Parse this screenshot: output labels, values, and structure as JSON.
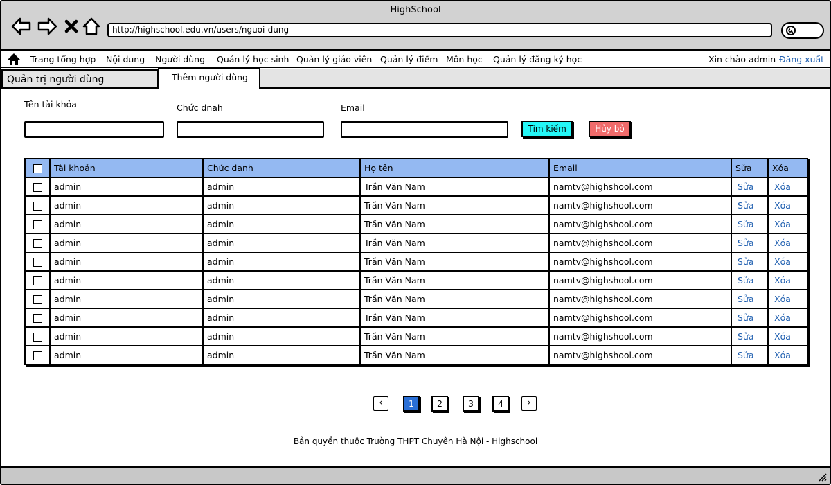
{
  "window": {
    "title": "HighSchool"
  },
  "browser": {
    "url": "http://highschool.edu.vn/users/nguoi-dung",
    "icons": [
      "back-arrow-icon",
      "forward-arrow-icon",
      "close-icon",
      "home-icon",
      "search-icon"
    ]
  },
  "menu": {
    "items": [
      {
        "label": "Trang tổng hợp"
      },
      {
        "label": "Nội dung"
      },
      {
        "label": "Người dùng"
      },
      {
        "label": "Quản lý học sinh"
      },
      {
        "label": "Quản lý giáo viên"
      },
      {
        "label": "Quản lý điểm"
      },
      {
        "label": "Môn học"
      },
      {
        "label": "Quản lý đăng ký học"
      }
    ],
    "greeting": "Xin chào admin",
    "logout": "Đăng xuất"
  },
  "tabs": [
    {
      "label": "Quản trị người dùng"
    },
    {
      "label": "Thêm người dùng"
    }
  ],
  "filters": {
    "account_label": "Tên tài khỏa",
    "title_label": "Chức dnah",
    "email_label": "Email",
    "account_value": "",
    "title_value": "",
    "email_value": "",
    "search_button": "Tìm kiếm",
    "cancel_button": "Hủy bỏ"
  },
  "table": {
    "headers": [
      "Tài khoản",
      "Chức danh",
      "Họ tên",
      "Email",
      "Sửa",
      "Xóa"
    ],
    "rows": [
      {
        "account": "admin",
        "title": "admin",
        "name": "Trần Văn Nam",
        "email": "namtv@highshool.com",
        "edit": "Sửa",
        "delete": "Xóa"
      },
      {
        "account": "admin",
        "title": "admin",
        "name": "Trần Văn Nam",
        "email": "namtv@highshool.com",
        "edit": "Sửa",
        "delete": "Xóa"
      },
      {
        "account": "admin",
        "title": "admin",
        "name": "Trần Văn Nam",
        "email": "namtv@highshool.com",
        "edit": "Sửa",
        "delete": "Xóa"
      },
      {
        "account": "admin",
        "title": "admin",
        "name": "Trần Văn Nam",
        "email": "namtv@highshool.com",
        "edit": "Sửa",
        "delete": "Xóa"
      },
      {
        "account": "admin",
        "title": "admin",
        "name": "Trần Văn Nam",
        "email": "namtv@highshool.com",
        "edit": "Sửa",
        "delete": "Xóa"
      },
      {
        "account": "admin",
        "title": "admin",
        "name": "Trần Văn Nam",
        "email": "namtv@highshool.com",
        "edit": "Sửa",
        "delete": "Xóa"
      },
      {
        "account": "admin",
        "title": "admin",
        "name": "Trần Văn Nam",
        "email": "namtv@highshool.com",
        "edit": "Sửa",
        "delete": "Xóa"
      },
      {
        "account": "admin",
        "title": "admin",
        "name": "Trần Văn Nam",
        "email": "namtv@highshool.com",
        "edit": "Sửa",
        "delete": "Xóa"
      },
      {
        "account": "admin",
        "title": "admin",
        "name": "Trần Văn Nam",
        "email": "namtv@highshool.com",
        "edit": "Sửa",
        "delete": "Xóa"
      },
      {
        "account": "admin",
        "title": "admin",
        "name": "Trần Văn Nam",
        "email": "namtv@highshool.com",
        "edit": "Sửa",
        "delete": "Xóa"
      }
    ]
  },
  "pagination": {
    "prev": "‹",
    "next": "›",
    "pages": [
      "1",
      "2",
      "3",
      "4"
    ],
    "active_page": "1"
  },
  "footer": {
    "text": "Bản quyền thuộc Trường THPT Chuyên Hà Nội - Highschool"
  },
  "colors": {
    "chrome": "#d2d2d2",
    "header_row": "#94b9f2",
    "search_button": "#24f7f7",
    "cancel_button": "#f06b6b",
    "link": "#1f5fb0",
    "active_page": "#2a6fd6"
  }
}
